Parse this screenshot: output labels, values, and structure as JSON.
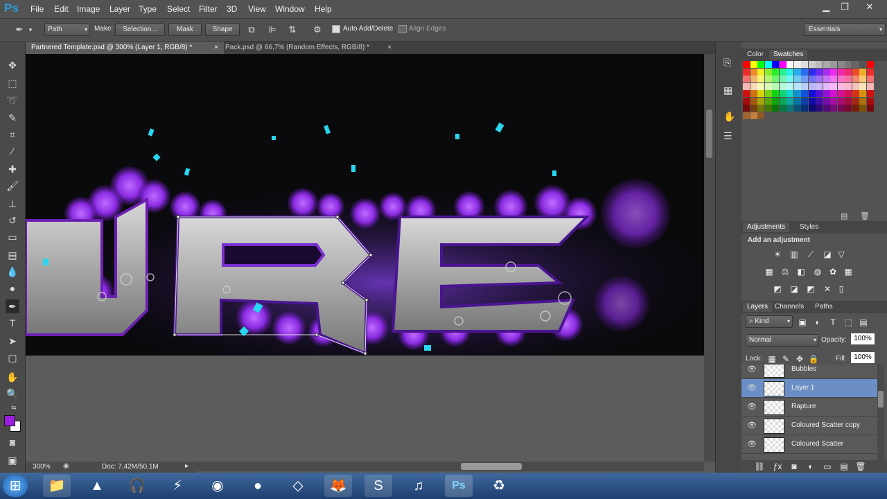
{
  "app": {
    "logo": "Ps"
  },
  "menu": [
    "File",
    "Edit",
    "Image",
    "Layer",
    "Type",
    "Select",
    "Filter",
    "3D",
    "View",
    "Window",
    "Help"
  ],
  "window_controls": {
    "minimize": "▁",
    "restore": "❐",
    "close": "✕"
  },
  "options": {
    "mode": "Path",
    "make_label": "Make:",
    "selection_label": "Selection...",
    "mask_label": "Mask",
    "shape_label": "Shape",
    "auto_add_delete": "Auto Add/Delete",
    "auto_add_delete_checked": true,
    "align_edges": "Align Edges",
    "workspace": "Essentials"
  },
  "tabs": [
    {
      "label": "Partnered Template.psd @ 300% (Layer 1, RGB/8) *",
      "close": "×",
      "active": true
    },
    {
      "label": "Pack.psd @ 66,7% (Random Effects, RGB/8) *",
      "close": "×",
      "active": false
    }
  ],
  "status": {
    "zoom": "300%",
    "doc": "Doc: 7,42M/50,1M"
  },
  "panels": {
    "color_tab": "Color",
    "swatches_tab": "Swatches",
    "adjustments_tab": "Adjustments",
    "styles_tab": "Styles",
    "add_adjustment": "Add an adjustment",
    "layers_tab": "Layers",
    "channels_tab": "Channels",
    "paths_tab": "Paths",
    "kind_filter": "Kind",
    "blend_mode": "Normal",
    "opacity_label": "Opacity:",
    "opacity_value": "100%",
    "lock_label": "Lock:",
    "fill_label": "Fill:",
    "fill_value": "100%"
  },
  "layers": [
    {
      "name": "Bubbles",
      "selected": false
    },
    {
      "name": "Layer 1",
      "selected": true
    },
    {
      "name": "Rapture",
      "selected": false
    },
    {
      "name": "Coloured Scatter copy",
      "selected": false
    },
    {
      "name": "Coloured Scatter",
      "selected": false
    }
  ],
  "colors": {
    "foreground": "#9b1de0",
    "background": "#ffffff",
    "selected_layer": "#6b8fc4",
    "accent_purple": "#8a2be2"
  },
  "taskbar": {
    "items": [
      "start-orb",
      "file-explorer",
      "vlc",
      "audio",
      "zip",
      "steam",
      "browser",
      "paint",
      "firefox",
      "skype",
      "itunes",
      "photoshop",
      "recycle"
    ]
  }
}
